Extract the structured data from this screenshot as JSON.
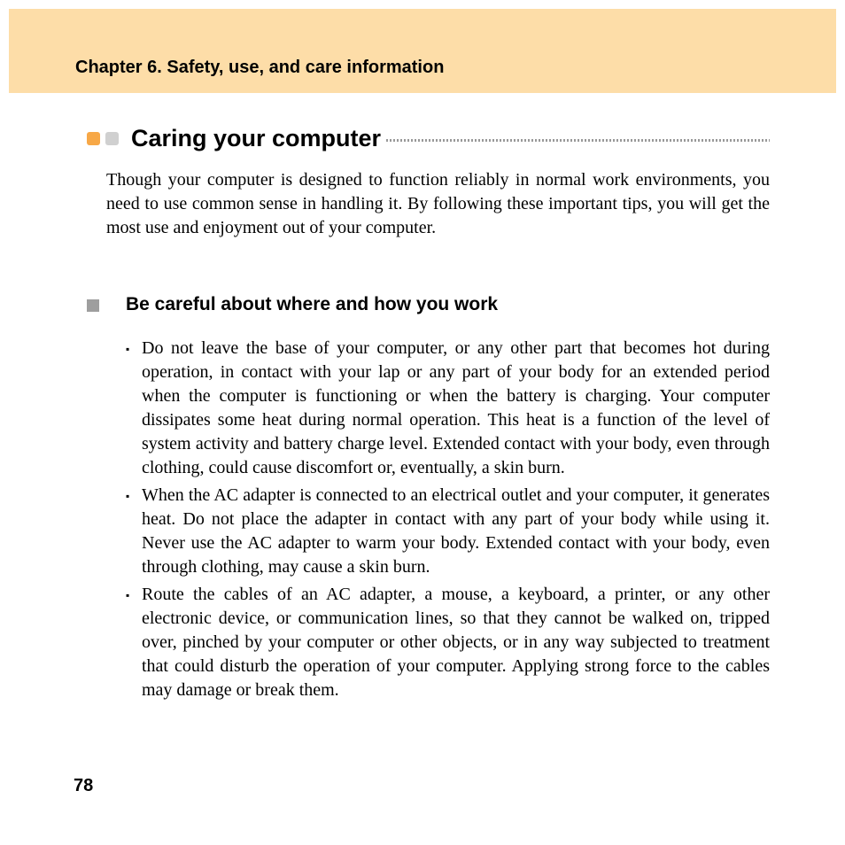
{
  "chapter": "Chapter 6. Safety, use, and care information",
  "section_title": "Caring your computer",
  "intro": "Though your computer is designed to function reliably in normal work environments, you need to use common sense in handling it. By following these important tips, you will get the most use and enjoyment out of your computer.",
  "subheading": "Be careful about where and how you work",
  "bullets": [
    "Do not leave the base of your computer, or any other part that becomes hot during operation, in contact with your lap or any part of your body for an extended period when the computer is functioning or when the battery is charging. Your computer dissipates some heat during normal operation. This heat is a function of the level of system activity and battery charge level. Extended contact with your body, even through clothing, could cause discomfort or, eventually, a skin burn.",
    "When the AC adapter is connected to an electrical outlet and your computer, it generates heat. Do not place the adapter in contact with any part of your body while using it. Never use the AC adapter to warm your body. Extended contact with your body, even through clothing, may cause a skin burn.",
    "Route the cables of an AC adapter, a mouse, a keyboard, a printer, or any other electronic device, or communication lines, so that they cannot be walked on, tripped over, pinched by your computer or other objects, or in any way subjected to treatment that could disturb the operation of your computer. Applying strong force to the cables may damage or break them."
  ],
  "page_number": "78"
}
